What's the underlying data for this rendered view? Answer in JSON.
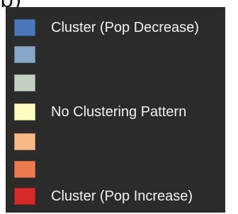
{
  "figure_label": "b)",
  "legend": {
    "items": [
      {
        "label": "Cluster (Pop Decrease)",
        "color": "#4a78b9"
      },
      {
        "label": "",
        "color": "#88a6c6"
      },
      {
        "label": "",
        "color": "#c3d1c3"
      },
      {
        "label": "No Clustering Pattern",
        "color": "#fdfdbf"
      },
      {
        "label": "",
        "color": "#f8b888"
      },
      {
        "label": "",
        "color": "#ee7a52"
      },
      {
        "label": "Cluster (Pop Increase)",
        "color": "#d62a2a"
      }
    ]
  }
}
